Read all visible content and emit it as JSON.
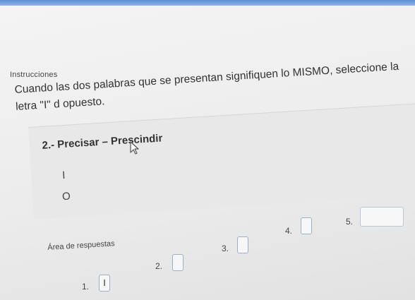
{
  "instructions": {
    "heading": "Instrucciones",
    "text": "Cuando las dos palabras que se presentan signifiquen lo MISMO, seleccione la letra \"I\" d opuesto."
  },
  "question": {
    "title": "2.- Precisar – Prescindir",
    "options": [
      "I",
      "O"
    ]
  },
  "answers": {
    "heading": "Área de respuestas",
    "slots": [
      {
        "number": "1.",
        "value": "I"
      },
      {
        "number": "2.",
        "value": ""
      },
      {
        "number": "3.",
        "value": ""
      },
      {
        "number": "4.",
        "value": ""
      },
      {
        "number": "5.",
        "value": ""
      }
    ]
  },
  "colors": {
    "topbar": "#5b8ed6",
    "answer_box_border": "#9ab0c8"
  },
  "icons": {
    "cursor": "mouse-pointer-icon"
  }
}
